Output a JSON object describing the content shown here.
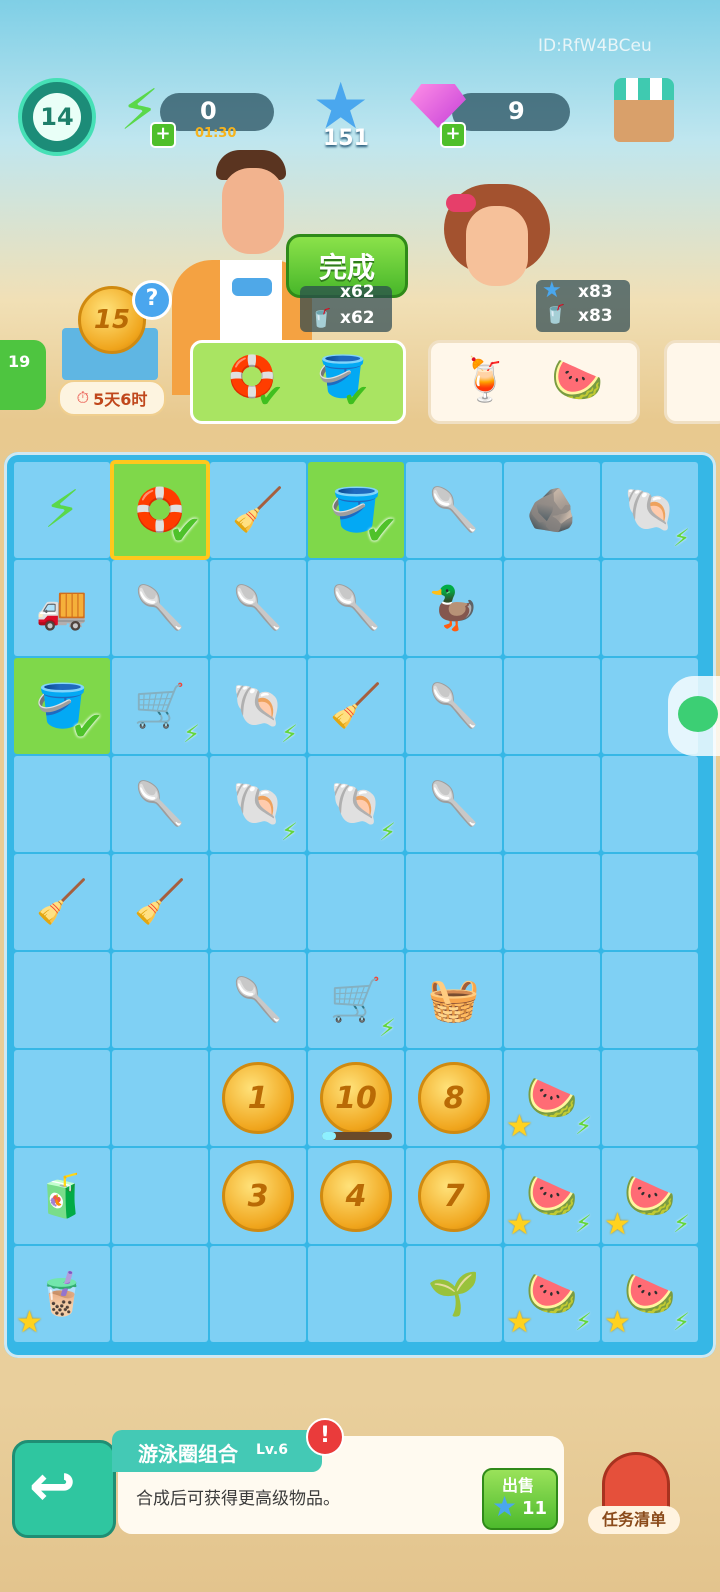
{
  "player_id": "ID:RfW4BCeu",
  "level": "14",
  "energy": {
    "value": "0",
    "timer": "01:30"
  },
  "stars": "151",
  "gems": "9",
  "complete_button": "完成",
  "chars": {
    "man": {
      "req1": "x62",
      "req2": "x62"
    },
    "woman": {
      "req1": "x83",
      "req2": "x83"
    }
  },
  "coin_box": {
    "value": "15",
    "timer": "5天6时"
  },
  "side_level": "19",
  "coins": {
    "r6c2": "1",
    "r6c3": "10",
    "r6c4": "8",
    "r7c2": "3",
    "r7c3": "4",
    "r7c4": "7"
  },
  "selected_item": {
    "name": "游泳圈组合",
    "level": "Lv.6",
    "desc": "合成后可获得更高级物品。"
  },
  "sell": {
    "label": "出售",
    "price": "11"
  },
  "task_list": "任务清单",
  "icons": {
    "energy": "lightning-icon",
    "star": "star-icon",
    "gem": "gem-icon",
    "shop": "shop-icon",
    "back": "back-arrow-icon",
    "mailbox": "mailbox-icon"
  }
}
